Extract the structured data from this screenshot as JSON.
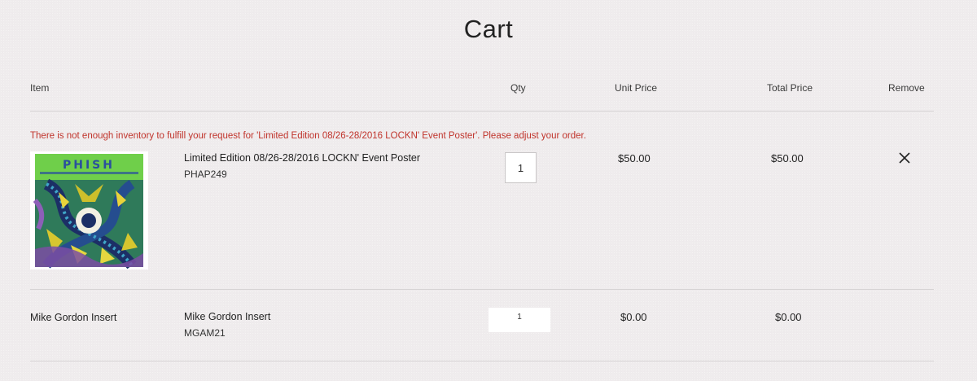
{
  "page": {
    "title": "Cart"
  },
  "table": {
    "headers": {
      "item": "Item",
      "qty": "Qty",
      "unit_price": "Unit Price",
      "total_price": "Total Price",
      "remove": "Remove"
    }
  },
  "error_message": "There is not enough inventory to fulfill your request for 'Limited Edition 08/26-28/2016 LOCKN' Event Poster'. Please adjust your order.",
  "items": [
    {
      "image_text": "PHISH",
      "name": "Limited Edition 08/26-28/2016 LOCKN' Event Poster",
      "sku": "PHAP249",
      "qty": "1",
      "unit_price": "$50.00",
      "total_price": "$50.00",
      "remove_icon": "close-icon"
    },
    {
      "label": "Mike Gordon Insert",
      "name": "Mike Gordon Insert",
      "sku": "MGAM21",
      "qty": "1",
      "unit_price": "$0.00",
      "total_price": "$0.00"
    }
  ],
  "colors": {
    "error": "#c0332b",
    "background": "#efeced",
    "divider": "#d6d3d4"
  }
}
